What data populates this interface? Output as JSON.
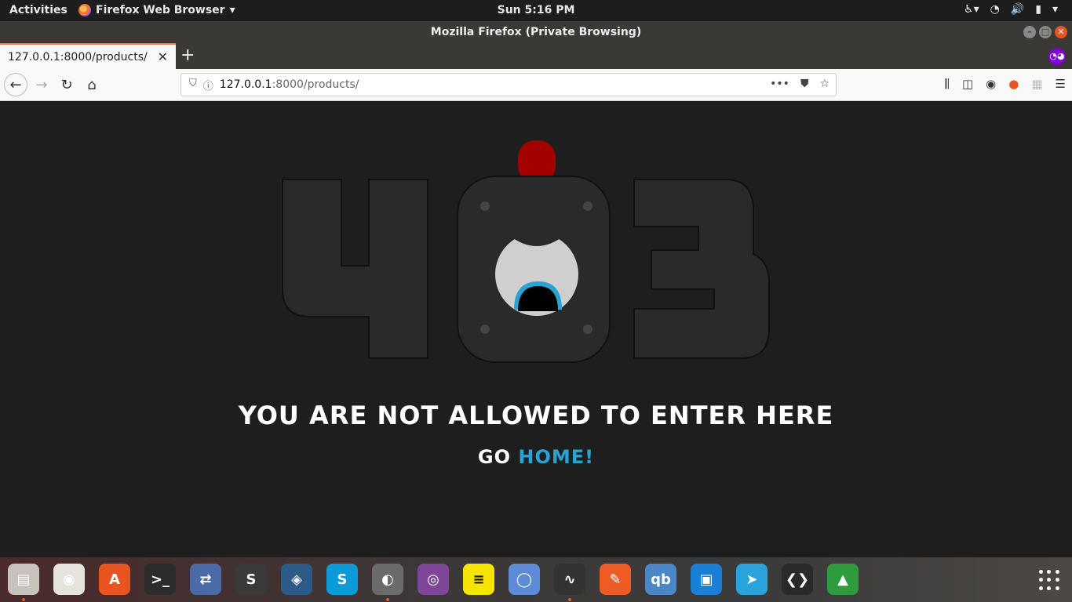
{
  "topbar": {
    "activities": "Activities",
    "app_menu": "Firefox Web Browser",
    "clock": "Sun  5:16 PM"
  },
  "window": {
    "title": "Mozilla Firefox (Private Browsing)"
  },
  "tab": {
    "label": "127.0.0.1:8000/products/"
  },
  "urlbar": {
    "host": "127.0.0.1",
    "rest": ":8000/products/"
  },
  "page": {
    "code_left": "4",
    "code_right": "3",
    "message": "YOU ARE NOT ALLOWED TO ENTER HERE",
    "go_prefix": "GO ",
    "go_link": "HOME!",
    "colors": {
      "background": "#1e1e1e",
      "digit": "#2a2a2a",
      "alarm": "#a30000",
      "link": "#2ba2d4"
    }
  },
  "dock": {
    "apps": [
      {
        "name": "files",
        "color": "#c7c2bb",
        "glyph": "▤"
      },
      {
        "name": "rhythmbox",
        "color": "#e6e3dc",
        "glyph": "◉"
      },
      {
        "name": "software",
        "color": "#e95420",
        "glyph": "A"
      },
      {
        "name": "terminal",
        "color": "#2c2c2c",
        "glyph": ">_"
      },
      {
        "name": "network",
        "color": "#4a6aa8",
        "glyph": "⇄"
      },
      {
        "name": "sublime",
        "color": "#3a3a3a",
        "glyph": "S"
      },
      {
        "name": "mysql-workbench",
        "color": "#2d5a87",
        "glyph": "◈"
      },
      {
        "name": "skype",
        "color": "#0a9bd8",
        "glyph": "S"
      },
      {
        "name": "firefox",
        "color": "#6b6b6b",
        "glyph": "◐"
      },
      {
        "name": "tor",
        "color": "#7d4698",
        "glyph": "◎"
      },
      {
        "name": "notes",
        "color": "#f5e500",
        "glyph": "≡"
      },
      {
        "name": "chromium",
        "color": "#5e8bd6",
        "glyph": "◯"
      },
      {
        "name": "system-monitor",
        "color": "#333",
        "glyph": "∿"
      },
      {
        "name": "postman",
        "color": "#ef5b25",
        "glyph": "✎"
      },
      {
        "name": "qbittorrent",
        "color": "#4b86c6",
        "glyph": "qb"
      },
      {
        "name": "anbox",
        "color": "#1a7fd6",
        "glyph": "▣"
      },
      {
        "name": "telegram",
        "color": "#2aa3dc",
        "glyph": "➤"
      },
      {
        "name": "vscode",
        "color": "#2a2a2a",
        "glyph": "❮❯"
      },
      {
        "name": "rocket",
        "color": "#2e9c3e",
        "glyph": "▲"
      }
    ]
  }
}
